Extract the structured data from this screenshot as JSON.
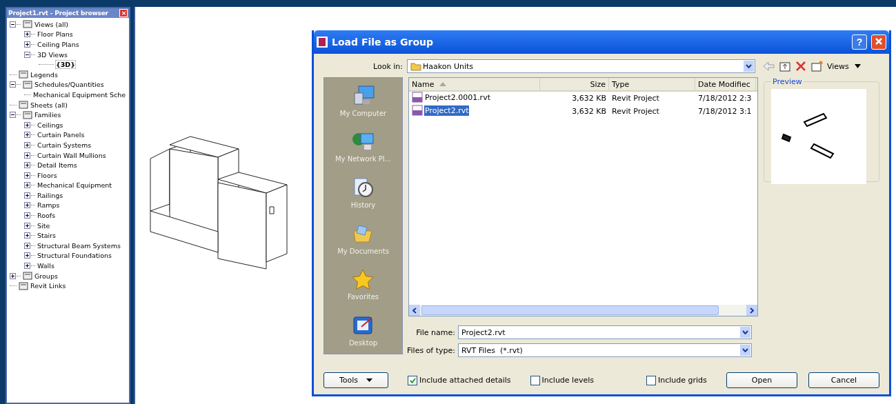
{
  "browser": {
    "title": "Project1.rvt - Project browser",
    "close": "×",
    "tree": [
      {
        "label": "Views (all)",
        "expanded": true,
        "selected": false,
        "children": [
          {
            "label": "Floor Plans",
            "expanded": false,
            "selected": false
          },
          {
            "label": "Ceiling Plans",
            "expanded": false,
            "selected": false
          },
          {
            "label": "3D Views",
            "expanded": true,
            "selected": false,
            "children": [
              {
                "label": "{3D}",
                "selected": true
              }
            ]
          }
        ]
      },
      {
        "label": "Legends",
        "selected": false
      },
      {
        "label": "Schedules/Quantities",
        "expanded": true,
        "selected": false,
        "children": [
          {
            "label": "Mechanical Equipment Sche",
            "selected": false
          }
        ]
      },
      {
        "label": "Sheets (all)",
        "selected": false
      },
      {
        "label": "Families",
        "expanded": true,
        "selected": false,
        "children": [
          {
            "label": "Ceilings",
            "expanded": false,
            "selected": false
          },
          {
            "label": "Curtain Panels",
            "expanded": false,
            "selected": false
          },
          {
            "label": "Curtain Systems",
            "expanded": false,
            "selected": false
          },
          {
            "label": "Curtain Wall Mullions",
            "expanded": false,
            "selected": false
          },
          {
            "label": "Detail Items",
            "expanded": false,
            "selected": false
          },
          {
            "label": "Floors",
            "expanded": false,
            "selected": false
          },
          {
            "label": "Mechanical Equipment",
            "expanded": false,
            "selected": false
          },
          {
            "label": "Railings",
            "expanded": false,
            "selected": false
          },
          {
            "label": "Ramps",
            "expanded": false,
            "selected": false
          },
          {
            "label": "Roofs",
            "expanded": false,
            "selected": false
          },
          {
            "label": "Site",
            "expanded": false,
            "selected": false
          },
          {
            "label": "Stairs",
            "expanded": false,
            "selected": false
          },
          {
            "label": "Structural Beam Systems",
            "expanded": false,
            "selected": false
          },
          {
            "label": "Structural Foundations",
            "expanded": false,
            "selected": false
          },
          {
            "label": "Walls",
            "expanded": false,
            "selected": false
          }
        ]
      },
      {
        "label": "Groups",
        "expanded": false,
        "selected": false
      },
      {
        "label": "Revit Links",
        "selected": false
      }
    ]
  },
  "dialog": {
    "title": "Load File as Group",
    "help": "?",
    "look_in": {
      "label": "Look in:",
      "value": "Haakon Units"
    },
    "views_menu": "Views",
    "places": [
      {
        "label": "My Computer"
      },
      {
        "label": "My Network Pl..."
      },
      {
        "label": "History"
      },
      {
        "label": "My Documents"
      },
      {
        "label": "Favorites"
      },
      {
        "label": "Desktop"
      }
    ],
    "columns": [
      "Name",
      "Size",
      "Type",
      "Date Modifiec"
    ],
    "files": [
      {
        "name": "Project2.0001.rvt",
        "size": "3,632 KB",
        "type": "Revit Project",
        "date": "7/18/2012 2:3",
        "selected": false
      },
      {
        "name": "Project2.rvt",
        "size": "3,632 KB",
        "type": "Revit Project",
        "date": "7/18/2012 3:1",
        "selected": true
      }
    ],
    "preview_label": "Preview",
    "file_name": {
      "label": "File name:",
      "value": "Project2.rvt"
    },
    "file_type": {
      "label": "Files of type:",
      "value": "RVT Files  (*.rvt)"
    },
    "tools": "Tools",
    "options": [
      {
        "label": "Include attached details",
        "checked": true
      },
      {
        "label": "Include levels",
        "checked": false
      },
      {
        "label": "Include grids",
        "checked": false
      }
    ],
    "buttons": [
      "Open",
      "Cancel"
    ]
  }
}
